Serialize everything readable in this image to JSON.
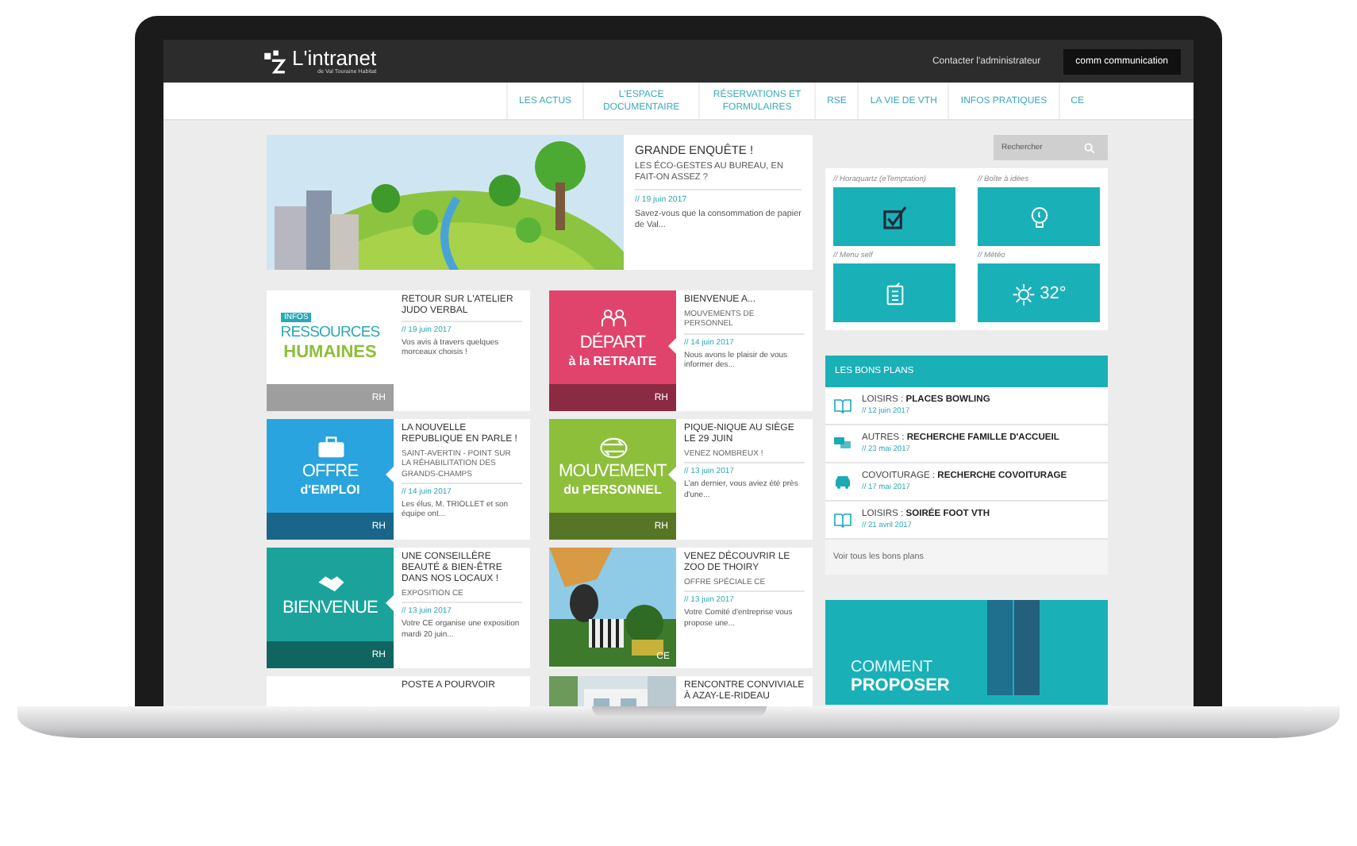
{
  "header": {
    "logo_title": "L'intranet",
    "logo_subtitle": "de Val Touraine Habitat",
    "contact_link": "Contacter l'administrateur",
    "user": "comm communication"
  },
  "nav": [
    {
      "label": "LES ACTUS"
    },
    {
      "label": "L'ESPACE DOCUMENTAIRE"
    },
    {
      "label": "RÉSERVATIONS ET FORMULAIRES"
    },
    {
      "label": "RSE"
    },
    {
      "label": "LA VIE DE VTH"
    },
    {
      "label": "INFOS PRATIQUES"
    },
    {
      "label": "CE"
    }
  ],
  "search": {
    "placeholder": "Rechercher"
  },
  "featured": {
    "title": "GRANDE ENQUÊTE !",
    "subtitle": "LES ÉCO-GESTES AU BUREAU, EN FAIT-ON ASSEZ ?",
    "date": "// 19 juin 2017",
    "excerpt": "Savez-vous que la consommation de papier de Val..."
  },
  "cards": [
    {
      "kind": "tile",
      "tile": {
        "kind": "text",
        "tag": "INFOS",
        "line1": "RESSOURCES",
        "line2": "HUMAINES",
        "color": "#ffffff",
        "footer": "RH"
      },
      "title": "RETOUR SUR L'ATELIER JUDO VERBAL",
      "date": "// 19 juin 2017",
      "excerpt": "Vos avis à travers quelques morceaux choisis !"
    },
    {
      "kind": "tile",
      "tile": {
        "kind": "icon",
        "line1": "DÉPART",
        "line2": "à la RETRAITE",
        "color": "#e0446c",
        "footer": "RH"
      },
      "title": "BIENVENUE A...",
      "subtitle": "MOUVEMENTS DE PERSONNEL",
      "date": "// 14 juin 2017",
      "excerpt": "Nous avons le plaisir de vous informer des..."
    },
    {
      "kind": "tile",
      "tile": {
        "kind": "icon",
        "line1": "OFFRE",
        "line2": "d'EMPLOI",
        "color": "#2aa4de",
        "footer": "RH"
      },
      "title": "LA NOUVELLE REPUBLIQUE EN PARLE !",
      "subtitle": "SAINT-AVERTIN - POINT SUR LA RÉHABILITATION DES GRANDS-CHAMPS",
      "date": "// 14 juin 2017",
      "excerpt": "Les élus, M. TRIOLLET et son équipe ont..."
    },
    {
      "kind": "tile",
      "tile": {
        "kind": "icon",
        "line1": "MOUVEMENT",
        "line2": "du PERSONNEL",
        "color": "#8dbf3b",
        "footer": "RH"
      },
      "title": "PIQUE-NIQUE AU SIÈGE LE 29 JUIN",
      "subtitle": "VENEZ NOMBREUX !",
      "date": "// 13 juin 2017",
      "excerpt": "L'an dernier, vous aviez été près d'une..."
    },
    {
      "kind": "tile",
      "tile": {
        "kind": "icon",
        "line1": "BIENVENUE",
        "color": "#1ba39b",
        "footer": "RH"
      },
      "title": "UNE CONSEILLÈRE BEAUTÉ & BIEN-ÊTRE DANS NOS LOCAUX !",
      "subtitle": "EXPOSITION CE",
      "date": "// 13 juin 2017",
      "excerpt": "Votre CE organise une exposition mardi 20 juin..."
    },
    {
      "badge": "CE",
      "title": "VENEZ DÉCOUVRIR LE ZOO DE THOIRY",
      "subtitle": "OFFRE SPÉCIALE CE",
      "date": "// 13 juin 2017",
      "excerpt": "Votre Comité d'entreprise vous propose une..."
    },
    {
      "kind": "blank",
      "title": "POSTE A POURVOIR"
    },
    {
      "title": "RENCONTRE CONVIVIALE À AZAY-LE-RIDEAU"
    }
  ],
  "widgets": [
    {
      "label": "// Horaquartz (eTemptation)"
    },
    {
      "label": "// Boîte à idées"
    },
    {
      "label": "// Menu self"
    },
    {
      "label": "// Météo",
      "reading": "32°"
    }
  ],
  "bons_plans": {
    "title": "LES BONS PLANS",
    "items": [
      {
        "category": "LOISIRS :",
        "title": "PLACES BOWLING",
        "date": "// 12 juin 2017"
      },
      {
        "category": "AUTRES :",
        "title": "RECHERCHE FAMILLE D'ACCUEIL",
        "date": "// 23 mai 2017"
      },
      {
        "category": "COVOITURAGE :",
        "title": "RECHERCHE COVOITURAGE",
        "date": "// 17 mai 2017"
      },
      {
        "category": "LOISIRS :",
        "title": "SOIRÉE FOOT VTH",
        "date": "// 21 avril 2017"
      }
    ],
    "link": "Voir tous les bons plans"
  },
  "promo": {
    "line1": "COMMENT",
    "line2": "PROPOSER"
  }
}
